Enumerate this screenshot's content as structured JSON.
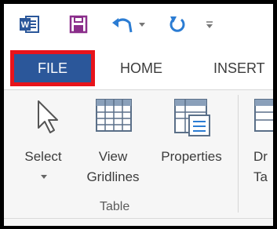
{
  "qat": {
    "icons": [
      "word-icon",
      "save-icon",
      "undo-icon",
      "repeat-icon",
      "customize-dropdown-icon"
    ],
    "colors": {
      "word": "#2b579a",
      "save": "#8b2e8b",
      "undo": "#2b7cd3"
    }
  },
  "tabs": {
    "file": "FILE",
    "home": "HOME",
    "insert": "INSERT"
  },
  "ribbon": {
    "select_label": "Select",
    "view_label_1": "View",
    "view_label_2": "Gridlines",
    "properties_label": "Properties",
    "draw_label_1": "Dr",
    "draw_label_2": "Ta",
    "group_label": "Table"
  },
  "colors": {
    "file_tab_bg": "#2b579a",
    "highlight_border": "#e8141b",
    "ribbon_bg": "#f6f6f6"
  }
}
